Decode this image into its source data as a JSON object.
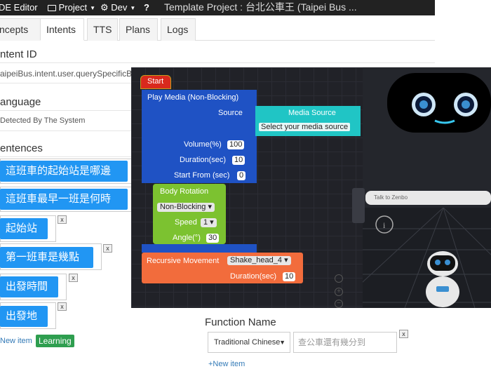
{
  "topbar": {
    "editor_label": "DE Editor",
    "project_menu": "Project",
    "dev_menu": "Dev",
    "help": "?",
    "title": "Template Project : 台北公車王 (Taipei Bus ..."
  },
  "tabs": [
    "ncepts",
    "Intents",
    "TTS",
    "Plans",
    "Logs"
  ],
  "intent_id": {
    "label": "ntent ID",
    "value": "aipeiBus.intent.user.querySpecificB"
  },
  "language": {
    "label": "anguage",
    "value": "Detected By The System"
  },
  "sentences": {
    "label": "entences",
    "items": [
      "這班車的起始站是哪邊",
      "這班車最早一班是何時",
      "起始站",
      "第一班車是幾點",
      "出發時間",
      "出發地"
    ],
    "remove": "x",
    "new_item": "New item",
    "learning": "Learning"
  },
  "blocks": {
    "start": "Start",
    "play_media": "Play Media (Non-Blocking)",
    "source": "Source",
    "media_source": "Media Source",
    "media_source_placeholder": "Select your media source",
    "volume_label": "Volume(%)",
    "volume": "100",
    "duration_label": "Duration(sec)",
    "duration": "10",
    "start_from_label": "Start From (sec)",
    "start_from": "0",
    "body_rotation": "Body Rotation",
    "non_blocking": "Non-Blocking",
    "speed_label": "Speed",
    "speed": "1",
    "angle_label": "Angle(°)",
    "angle": "30",
    "recursive_movement": "Recursive Movement",
    "movement": "Shake_head_4",
    "rm_duration_label": "Duration(sec)",
    "rm_duration": "10"
  },
  "preview": {
    "talk_placeholder": "Talk to Zenbo"
  },
  "function_name": {
    "label": "Function Name",
    "language": "Traditional Chinese",
    "value": "查公車還有幾分到",
    "remove": "x",
    "new_item": "+New item"
  },
  "colors": {
    "sentence_blue": "#2196f3",
    "block_blue": "#1f52c4",
    "block_green": "#7cc230",
    "block_orange": "#f26c3c",
    "block_teal": "#20c5c5",
    "start_red": "#d9291d"
  }
}
